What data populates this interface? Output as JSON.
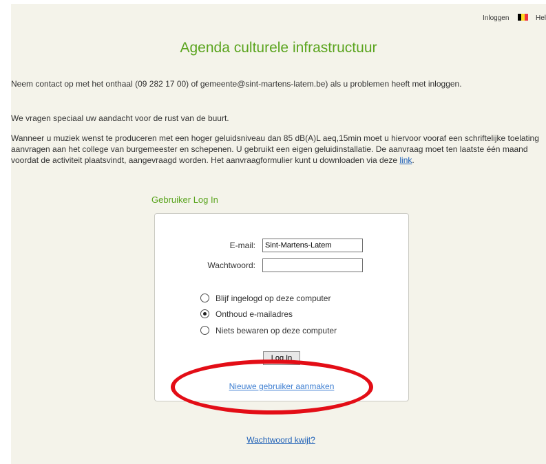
{
  "topnav": {
    "login_label": "Inloggen",
    "help_label": "Hel",
    "flag_colors": [
      "#000000",
      "#fdda24",
      "#ef3340"
    ]
  },
  "page": {
    "title": "Agenda culturele infrastructuur",
    "paragraph1": "Neem contact op met het onthaal (09 282 17 00) of gemeente@sint-martens-latem.be) als u problemen heeft met inloggen.",
    "paragraph2": "We vragen speciaal uw aandacht voor de rust van de buurt.",
    "paragraph3_text": "Wanneer u muziek wenst te produceren met een hoger geluidsniveau dan 85 dB(A)L aeq,15min moet u hiervoor vooraf een schriftelijke toelating aanvragen aan het college van burgemeester en schepenen. U gebruikt een eigen geluidinstallatie. De aanvraag moet ten laatste één maand voordat de activiteit plaatsvindt, aangevraagd worden. Het aanvraagformulier kunt u downloaden via deze ",
    "paragraph3_link": "link",
    "paragraph3_end": "."
  },
  "login": {
    "section_title": "Gebruiker Log In",
    "email_label": "E-mail:",
    "email_value": "Sint-Martens-Latem",
    "password_label": "Wachtwoord:",
    "password_value": "",
    "options": [
      {
        "label": "Blijf ingelogd op deze computer",
        "checked": false
      },
      {
        "label": "Onthoud e-mailadres",
        "checked": true
      },
      {
        "label": "Niets bewaren op deze computer",
        "checked": false
      }
    ],
    "login_button": "Log In",
    "new_user_link": "Nieuwe gebruiker aanmaken",
    "forgot_password_link": "Wachtwoord kwijt?"
  },
  "annotation": {
    "highlight_color": "#e30d16"
  }
}
